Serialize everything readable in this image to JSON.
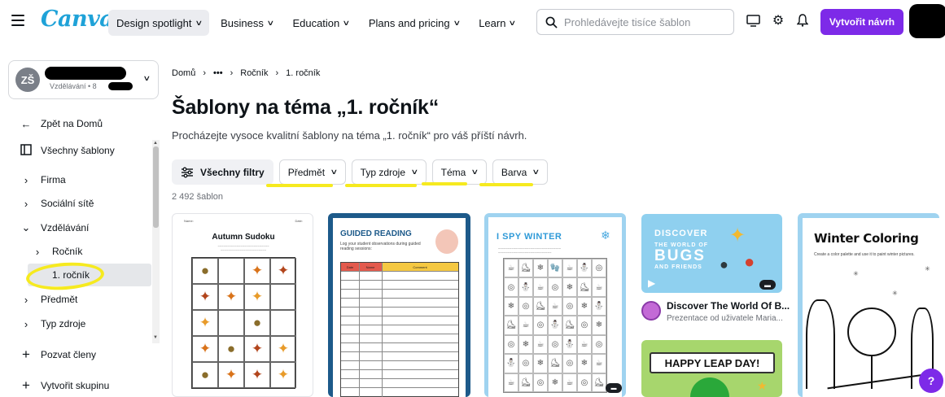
{
  "header": {
    "logo": "Canva",
    "nav": [
      {
        "label": "Design spotlight",
        "active": true
      },
      {
        "label": "Business",
        "active": false
      },
      {
        "label": "Education",
        "active": false
      },
      {
        "label": "Plans and pricing",
        "active": false
      },
      {
        "label": "Learn",
        "active": false
      }
    ],
    "search_placeholder": "Prohledávejte tisíce šablon",
    "create_label": "Vytvořit návrh",
    "icons": [
      "monitor-icon",
      "gear-icon",
      "bell-icon"
    ],
    "accent_color": "#7d2ae8"
  },
  "sidebar": {
    "team_initials": "ZŠ",
    "team_sub": "Vzdělávání • 8",
    "back": "Zpět na Domů",
    "all_templates": "Všechny šablony",
    "items": [
      {
        "label": "Firma",
        "expanded": false
      },
      {
        "label": "Sociální sítě",
        "expanded": false
      },
      {
        "label": "Vzdělávání",
        "expanded": true
      },
      {
        "label": "Ročník",
        "expanded": false
      },
      {
        "label": "1. ročník",
        "selected": true
      },
      {
        "label": "Předmět",
        "expanded": false
      },
      {
        "label": "Typ zdroje",
        "expanded": false
      }
    ],
    "invite": "Pozvat členy",
    "create_group": "Vytvořit skupinu"
  },
  "breadcrumb": [
    "Domů",
    "•••",
    "Ročník",
    "1. ročník"
  ],
  "page": {
    "title": "Šablony na téma „1. ročník“",
    "subtitle": "Procházejte vysoce kvalitní šablony na téma „1. ročník“ pro váš příští návrh.",
    "count": "2 492 šablon"
  },
  "filters": [
    {
      "label": "Všechny filtry",
      "icon": "sliders-icon"
    },
    {
      "label": "Předmět"
    },
    {
      "label": "Typ zdroje"
    },
    {
      "label": "Téma"
    },
    {
      "label": "Barva"
    }
  ],
  "cards": {
    "sudoku": {
      "title": "Autumn Sudoku",
      "name_label": "Name:",
      "date_label": "Date:"
    },
    "guided": {
      "title": "GUIDED READING",
      "sub": "Log your student observations during guided reading sessions:",
      "cols": [
        "Date",
        "Name",
        "Comment"
      ]
    },
    "spy": {
      "title": "I SPY WINTER"
    },
    "bugs": {
      "line1": "DISCOVER",
      "line2": "THE WORLD OF",
      "big": "BUGS",
      "line3": "AND FRIENDS",
      "title": "Discover The World Of B...",
      "sub": "Prezentace od uživatele Maria..."
    },
    "leap": {
      "title": "HAPPY LEAP DAY!"
    },
    "winter": {
      "title": "Winter Coloring",
      "sub": "Create a color palette and use it to paint winter pictures."
    }
  },
  "help_label": "?"
}
